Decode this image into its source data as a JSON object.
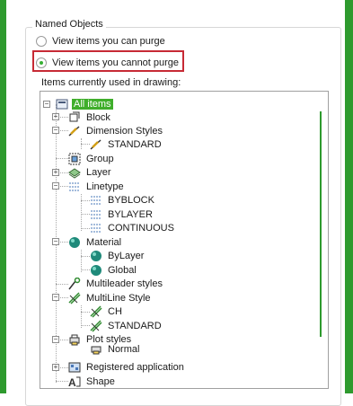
{
  "named_objects": {
    "group_label": "Named Objects",
    "radio_purge_label": "View items you can purge",
    "radio_cannot_label": "View items you cannot purge",
    "tree_caption": "Items currently used in drawing:"
  },
  "tree": {
    "root": "All items",
    "block": "Block",
    "dimension_styles": "Dimension Styles",
    "standard_dim": "STANDARD",
    "group": "Group",
    "layer": "Layer",
    "linetype": "Linetype",
    "byblock": "BYBLOCK",
    "bylayer": "BYLAYER",
    "continuous": "CONTINUOUS",
    "material": "Material",
    "mat_bylayer": "ByLayer",
    "mat_global": "Global",
    "multileader_styles": "Multileader styles",
    "multiline_style": "MultiLine Style",
    "ml_ch": "CH",
    "ml_standard": "STANDARD",
    "plot_styles": "Plot styles",
    "normal": "Normal",
    "registered_application": "Registered application",
    "shape": "Shape"
  },
  "colors": {
    "accent_green": "#3fae2b",
    "highlight_red": "#c72a35"
  },
  "icons": [
    "folder-icon",
    "block-icon",
    "dimension-style-icon",
    "group-icon",
    "layer-icon",
    "linetype-icon",
    "material-sphere-icon",
    "multileader-icon",
    "multiline-icon",
    "plot-style-icon",
    "registered-app-icon",
    "shape-icon"
  ]
}
